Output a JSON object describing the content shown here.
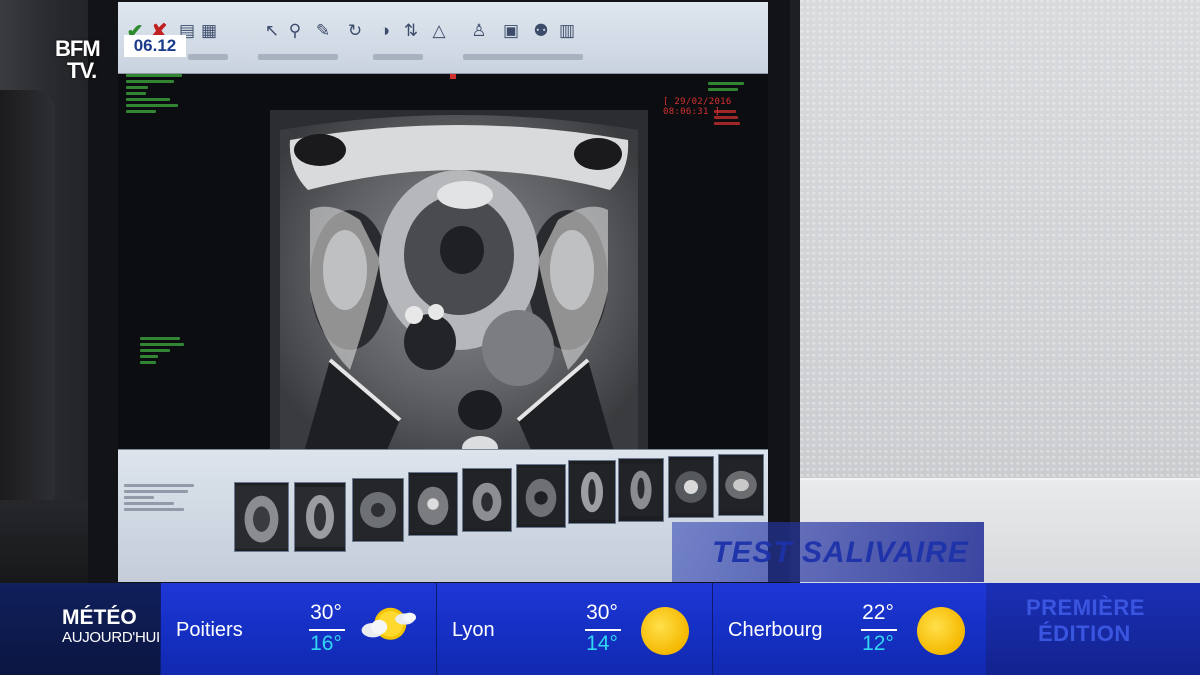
{
  "channel": {
    "logo_line1": "BFM",
    "logo_line2": "TV.",
    "clock": "06.12"
  },
  "monitor": {
    "timestamp": "[ 29/02/2016 08:06:31 ]"
  },
  "topic_banner": {
    "text": "TEST SALIVAIRE"
  },
  "weather": {
    "label_line1": "MÉTÉO",
    "label_line2": "AUJOURD'HUI",
    "cities": [
      {
        "name": "Poitiers",
        "high": "30°",
        "low": "16°",
        "icon": "sun-cloud-icon"
      },
      {
        "name": "Lyon",
        "high": "30°",
        "low": "14°",
        "icon": "sun-icon"
      },
      {
        "name": "Cherbourg",
        "high": "22°",
        "low": "12°",
        "icon": "sun-icon"
      }
    ],
    "edition_line1": "PREMIÈRE",
    "edition_line2": "ÉDITION"
  },
  "colors": {
    "ticker_blue": "#1530c4",
    "low_temp": "#31d6f0",
    "sun": "#f5b800",
    "clock_text": "#1a3a8a"
  }
}
